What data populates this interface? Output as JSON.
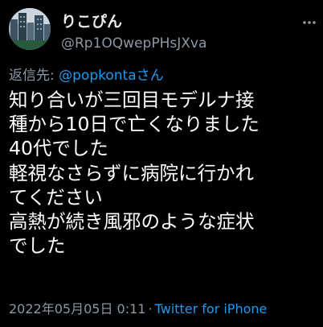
{
  "author": {
    "display_name": "りこぴん",
    "handle": "@Rp1OQwepPHsJXva"
  },
  "reply": {
    "prefix": "返信先: ",
    "to": "@popkontaさん"
  },
  "tweet": {
    "lines": [
      "知り合いが三回目モデルナ接",
      "種から10日で亡くなりました",
      "40代でした",
      "軽視なさらずに病院に行かれ",
      "てください",
      "高熱が続き風邪のような症状",
      "でした"
    ]
  },
  "meta": {
    "timestamp": "2022年05月05日 0:11",
    "separator": "·",
    "source": "Twitter for iPhone"
  },
  "icons": {
    "avatar": "avatar-city-buildings",
    "more": "more-options-icon"
  },
  "colors": {
    "background": "#000000",
    "text": "#ffffff",
    "secondary": "#8b98a5",
    "link": "#1d9bf0"
  }
}
